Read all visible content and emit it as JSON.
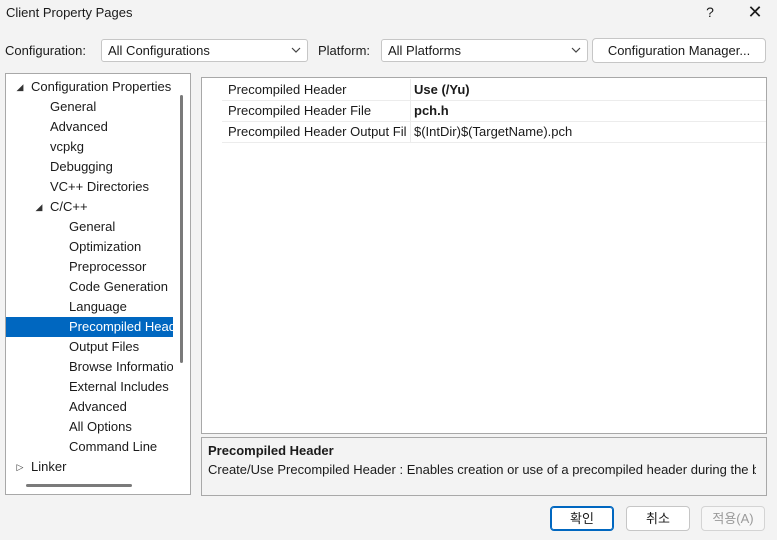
{
  "window": {
    "title": "Client Property Pages",
    "help_glyph": "?",
    "close_glyph": "✕"
  },
  "config_bar": {
    "configuration_label": "Configuration:",
    "configuration_value": "All Configurations",
    "platform_label": "Platform:",
    "platform_value": "All Platforms",
    "config_manager_label": "Configuration Manager..."
  },
  "tree": {
    "items": [
      {
        "label": "Configuration Properties",
        "expanded": true
      },
      {
        "label": "General"
      },
      {
        "label": "Advanced"
      },
      {
        "label": "vcpkg"
      },
      {
        "label": "Debugging"
      },
      {
        "label": "VC++ Directories"
      },
      {
        "label": "C/C++",
        "expanded": true
      },
      {
        "label": "General"
      },
      {
        "label": "Optimization"
      },
      {
        "label": "Preprocessor"
      },
      {
        "label": "Code Generation"
      },
      {
        "label": "Language"
      },
      {
        "label": "Precompiled Headers",
        "selected": true
      },
      {
        "label": "Output Files"
      },
      {
        "label": "Browse Information"
      },
      {
        "label": "External Includes"
      },
      {
        "label": "Advanced"
      },
      {
        "label": "All Options"
      },
      {
        "label": "Command Line"
      },
      {
        "label": "Linker",
        "expanded": false
      }
    ]
  },
  "grid": {
    "rows": [
      {
        "name": "Precompiled Header",
        "value": "Use (/Yu)",
        "bold": true
      },
      {
        "name": "Precompiled Header File",
        "value": "pch.h",
        "bold": true
      },
      {
        "name": "Precompiled Header Output File",
        "value": "$(IntDir)$(TargetName).pch",
        "bold": false
      }
    ]
  },
  "description": {
    "title": "Precompiled Header",
    "body": "Create/Use Precompiled Header : Enables creation or use of a precompiled header during the build."
  },
  "buttons": {
    "ok": "확인",
    "cancel": "취소",
    "apply": "적용(A)"
  },
  "colors": {
    "selection": "#0067c0",
    "window_bg": "#f3f3f3"
  }
}
